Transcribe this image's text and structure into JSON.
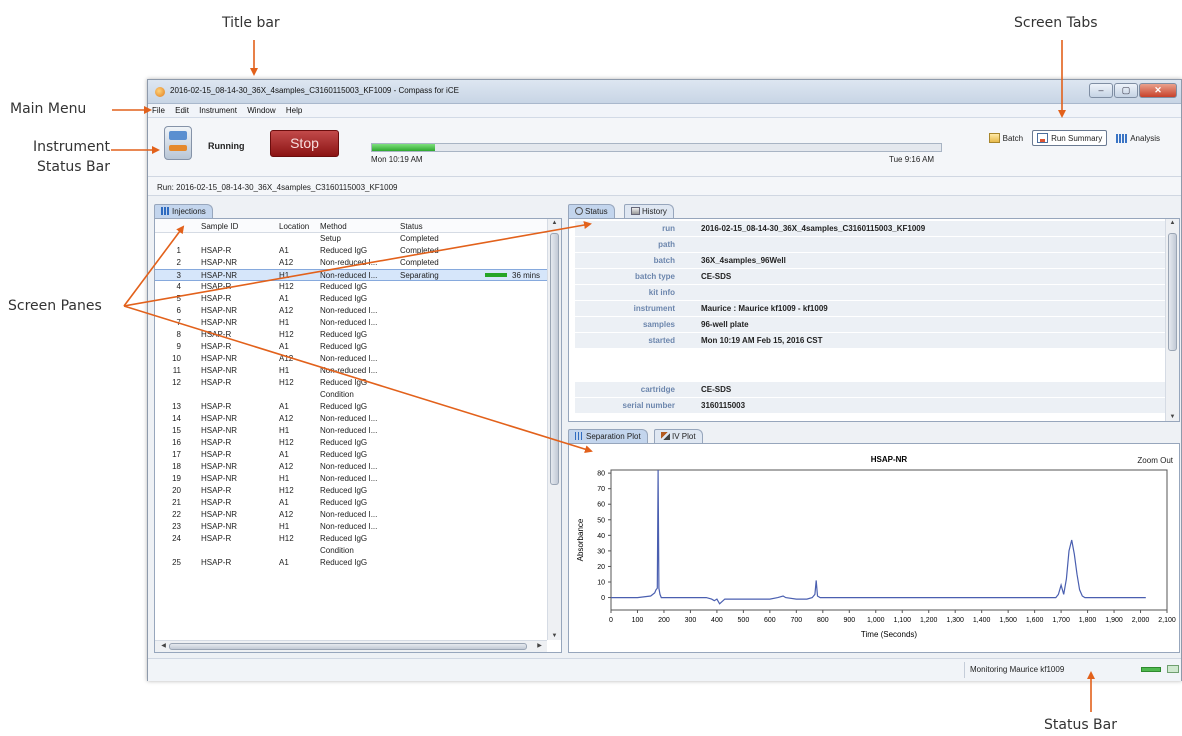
{
  "annotations": {
    "title_bar": "Title bar",
    "screen_tabs": "Screen Tabs",
    "main_menu": "Main Menu",
    "instrument_status_line1": "Instrument",
    "instrument_status_line2": "Status Bar",
    "screen_panes": "Screen Panes",
    "status_bar": "Status Bar"
  },
  "window": {
    "title": "2016-02-15_08-14-30_36X_4samples_C3160115003_KF1009 - Compass for iCE",
    "minimize": "–",
    "maximize": "▢",
    "close": "✕"
  },
  "menu": [
    "File",
    "Edit",
    "Instrument",
    "Window",
    "Help"
  ],
  "instrument": {
    "state": "Running",
    "stop_label": "Stop",
    "progress": 0.11,
    "start_time": "Mon 10:19 AM",
    "end_time": "Tue 9:16 AM"
  },
  "view_tabs": [
    "Batch",
    "Run Summary",
    "Analysis"
  ],
  "run_line": "Run:  2016-02-15_08-14-30_36X_4samples_C3160115003_KF1009",
  "injections": {
    "tab": "Injections",
    "columns": [
      "Sample ID",
      "Location",
      "Method",
      "Status"
    ],
    "rows": [
      {
        "num": "",
        "id": "",
        "loc": "",
        "method": "Setup",
        "status": "Completed",
        "extra": ""
      },
      {
        "num": "1",
        "id": "HSAP-R",
        "loc": "A1",
        "method": "Reduced IgG",
        "status": "Completed",
        "extra": ""
      },
      {
        "num": "2",
        "id": "HSAP-NR",
        "loc": "A12",
        "method": "Non-reduced I...",
        "status": "Completed",
        "extra": ""
      },
      {
        "num": "3",
        "id": "HSAP-NR",
        "loc": "H1",
        "method": "Non-reduced I...",
        "status": "Separating",
        "extra": "36 mins"
      },
      {
        "num": "4",
        "id": "HSAP-R",
        "loc": "H12",
        "method": "Reduced IgG",
        "status": "",
        "extra": ""
      },
      {
        "num": "5",
        "id": "HSAP-R",
        "loc": "A1",
        "method": "Reduced IgG",
        "status": "",
        "extra": ""
      },
      {
        "num": "6",
        "id": "HSAP-NR",
        "loc": "A12",
        "method": "Non-reduced I...",
        "status": "",
        "extra": ""
      },
      {
        "num": "7",
        "id": "HSAP-NR",
        "loc": "H1",
        "method": "Non-reduced I...",
        "status": "",
        "extra": ""
      },
      {
        "num": "8",
        "id": "HSAP-R",
        "loc": "H12",
        "method": "Reduced IgG",
        "status": "",
        "extra": ""
      },
      {
        "num": "9",
        "id": "HSAP-R",
        "loc": "A1",
        "method": "Reduced IgG",
        "status": "",
        "extra": ""
      },
      {
        "num": "10",
        "id": "HSAP-NR",
        "loc": "A12",
        "method": "Non-reduced I...",
        "status": "",
        "extra": ""
      },
      {
        "num": "11",
        "id": "HSAP-NR",
        "loc": "H1",
        "method": "Non-reduced I...",
        "status": "",
        "extra": ""
      },
      {
        "num": "12",
        "id": "HSAP-R",
        "loc": "H12",
        "method": "Reduced IgG",
        "status": "",
        "extra": ""
      },
      {
        "num": "",
        "id": "",
        "loc": "",
        "method": "Condition",
        "status": "",
        "extra": ""
      },
      {
        "num": "13",
        "id": "HSAP-R",
        "loc": "A1",
        "method": "Reduced IgG",
        "status": "",
        "extra": ""
      },
      {
        "num": "14",
        "id": "HSAP-NR",
        "loc": "A12",
        "method": "Non-reduced I...",
        "status": "",
        "extra": ""
      },
      {
        "num": "15",
        "id": "HSAP-NR",
        "loc": "H1",
        "method": "Non-reduced I...",
        "status": "",
        "extra": ""
      },
      {
        "num": "16",
        "id": "HSAP-R",
        "loc": "H12",
        "method": "Reduced IgG",
        "status": "",
        "extra": ""
      },
      {
        "num": "17",
        "id": "HSAP-R",
        "loc": "A1",
        "method": "Reduced IgG",
        "status": "",
        "extra": ""
      },
      {
        "num": "18",
        "id": "HSAP-NR",
        "loc": "A12",
        "method": "Non-reduced I...",
        "status": "",
        "extra": ""
      },
      {
        "num": "19",
        "id": "HSAP-NR",
        "loc": "H1",
        "method": "Non-reduced I...",
        "status": "",
        "extra": ""
      },
      {
        "num": "20",
        "id": "HSAP-R",
        "loc": "H12",
        "method": "Reduced IgG",
        "status": "",
        "extra": ""
      },
      {
        "num": "21",
        "id": "HSAP-R",
        "loc": "A1",
        "method": "Reduced IgG",
        "status": "",
        "extra": ""
      },
      {
        "num": "22",
        "id": "HSAP-NR",
        "loc": "A12",
        "method": "Non-reduced I...",
        "status": "",
        "extra": ""
      },
      {
        "num": "23",
        "id": "HSAP-NR",
        "loc": "H1",
        "method": "Non-reduced I...",
        "status": "",
        "extra": ""
      },
      {
        "num": "24",
        "id": "HSAP-R",
        "loc": "H12",
        "method": "Reduced IgG",
        "status": "",
        "extra": ""
      },
      {
        "num": "",
        "id": "",
        "loc": "",
        "method": "Condition",
        "status": "",
        "extra": ""
      },
      {
        "num": "25",
        "id": "HSAP-R",
        "loc": "A1",
        "method": "Reduced IgG",
        "status": "",
        "extra": ""
      }
    ]
  },
  "status_pane": {
    "tabs": [
      "Status",
      "History"
    ],
    "fields": [
      {
        "key": "run",
        "value": "2016-02-15_08-14-30_36X_4samples_C3160115003_KF1009"
      },
      {
        "key": "path",
        "value": ""
      },
      {
        "key": "batch",
        "value": "36X_4samples_96Well"
      },
      {
        "key": "batch type",
        "value": "CE-SDS"
      },
      {
        "key": "kit info",
        "value": ""
      },
      {
        "key": "instrument",
        "value": "Maurice : Maurice kf1009 - kf1009"
      },
      {
        "key": "samples",
        "value": "96-well plate"
      },
      {
        "key": "started",
        "value": "Mon 10:19 AM Feb 15, 2016 CST"
      },
      {
        "key": "cartridge",
        "value": "CE-SDS"
      },
      {
        "key": "serial number",
        "value": "3160115003"
      }
    ]
  },
  "plot_pane": {
    "tabs": [
      "Separation Plot",
      "IV Plot"
    ],
    "zoom_out": "Zoom Out"
  },
  "chart_data": {
    "type": "line",
    "title": "HSAP-NR",
    "xlabel": "Time (Seconds)",
    "ylabel": "Absorbance",
    "xlim": [
      0,
      2100
    ],
    "ylim": [
      -8,
      82
    ],
    "x_ticks": [
      "0",
      "100",
      "200",
      "300",
      "400",
      "500",
      "600",
      "700",
      "800",
      "900",
      "1,000",
      "1,100",
      "1,200",
      "1,300",
      "1,400",
      "1,500",
      "1,600",
      "1,700",
      "1,800",
      "1,900",
      "2,000",
      "2,100"
    ],
    "y_ticks": [
      "0",
      "10",
      "20",
      "30",
      "40",
      "50",
      "60",
      "70",
      "80"
    ],
    "color": "#4a5fb0",
    "series": [
      {
        "x": [
          0,
          100,
          150,
          165,
          170,
          175,
          178,
          181,
          185,
          190,
          210,
          300,
          360,
          380,
          390,
          400,
          410,
          430,
          460,
          500,
          560,
          600,
          630,
          650,
          660,
          700,
          740,
          760,
          770,
          775,
          780,
          790,
          820,
          1000,
          1200,
          1400,
          1600,
          1680,
          1690,
          1700,
          1710,
          1720,
          1730,
          1740,
          1750,
          1760,
          1770,
          1780,
          1790,
          1800,
          1850,
          1900,
          2000,
          2020
        ],
        "y": [
          0,
          0,
          1,
          3,
          5,
          6,
          84,
          6,
          2,
          0,
          0,
          0,
          0,
          -1,
          -2,
          -1,
          -4,
          -1,
          -1,
          -1,
          -1,
          -1,
          0,
          1,
          0,
          -1,
          -1,
          0,
          2,
          11,
          1,
          0,
          0,
          0,
          0,
          0,
          0,
          0,
          2,
          8,
          2,
          12,
          30,
          37,
          28,
          15,
          5,
          1,
          0,
          0,
          0,
          0,
          0,
          0
        ]
      }
    ]
  }
}
